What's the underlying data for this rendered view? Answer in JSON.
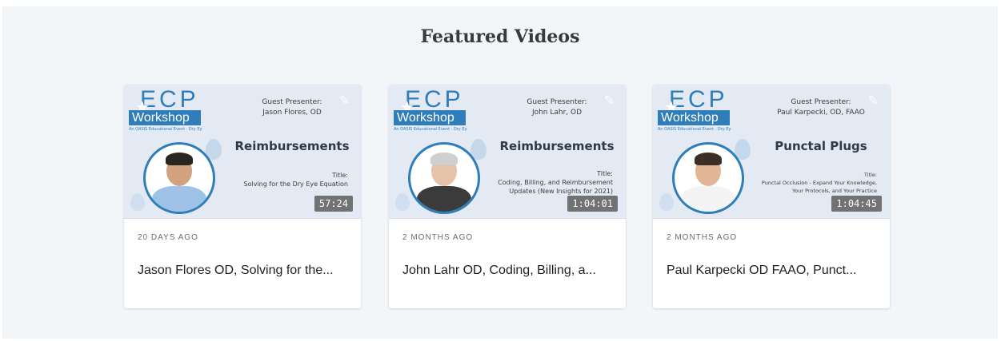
{
  "section": {
    "title": "Featured Videos"
  },
  "logo": {
    "ecp": "ECP",
    "workshop": "Workshop",
    "sub": "An OASIS Educational Event · Dry Eye · Vision Care · Practice Management"
  },
  "videos": [
    {
      "presenter_label": "Guest Presenter:",
      "presenter": "Jason Flores, OD",
      "topic": "Reimbursements",
      "title_label": "Title:",
      "thumb_title": "Solving for the Dry Eye Equation",
      "duration": "57:24",
      "age": "20 DAYS AGO",
      "title": "Jason Flores OD, Solving for the..."
    },
    {
      "presenter_label": "Guest Presenter:",
      "presenter": "John Lahr, OD",
      "topic": "Reimbursements",
      "title_label": "Title:",
      "thumb_title": "Coding, Billing, and Reimbursement Updates (New Insights for 2021)",
      "duration": "1:04:01",
      "age": "2 MONTHS AGO",
      "title": "John Lahr OD, Coding, Billing, a..."
    },
    {
      "presenter_label": "Guest Presenter:",
      "presenter": "Paul Karpecki, OD, FAAO",
      "topic": "Punctal Plugs",
      "title_label": "Title:",
      "thumb_title": "Punctal Occlusion - Expand Your Knowledge, Your Protocols, and Your Practice",
      "duration": "1:04:45",
      "age": "2 MONTHS AGO",
      "title": "Paul Karpecki OD FAAO, Punct..."
    }
  ],
  "icons": {
    "edit": "pencil-icon",
    "star": "star-icon",
    "drop": "droplet-icon"
  },
  "colors": {
    "brand": "#2f7db9",
    "background": "#f3f6f9",
    "thumb_bg": "#e3eaf3"
  }
}
